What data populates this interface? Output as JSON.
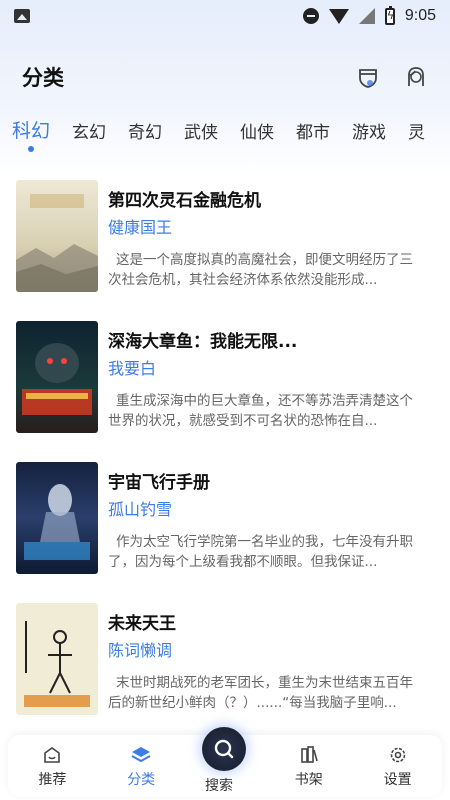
{
  "status": {
    "time": "9:05"
  },
  "header": {
    "title": "分类",
    "icons": [
      "shield-icon",
      "avatar-icon"
    ]
  },
  "tabs": [
    {
      "label": "科幻",
      "active": true
    },
    {
      "label": "玄幻",
      "active": false
    },
    {
      "label": "奇幻",
      "active": false
    },
    {
      "label": "武侠",
      "active": false
    },
    {
      "label": "仙侠",
      "active": false
    },
    {
      "label": "都市",
      "active": false
    },
    {
      "label": "游戏",
      "active": false
    },
    {
      "label": "灵",
      "active": false
    }
  ],
  "books": [
    {
      "title": "第四次灵石金融危机",
      "author": "健康国王",
      "description": "这是一个高度拟真的高魔社会，即便文明经历了三次社会危机，其社会经济体系依然没能形成..."
    },
    {
      "title": "深海大章鱼：我能无限...",
      "author": "我要白",
      "description": "重生成深海中的巨大章鱼，还不等苏浩弄清楚这个世界的状况，就感受到不可名状的恐怖在自..."
    },
    {
      "title": "宇宙飞行手册",
      "author": "孤山钓雪",
      "description": "作为太空飞行学院第一名毕业的我，七年没有升职了，因为每个上级看我都不顺眼。但我保证..."
    },
    {
      "title": "未来天王",
      "author": "陈词懒调",
      "description": "末世时期战死的老军团长，重生为末世结束五百年后的新世纪小鲜肉（？）......“每当我脑子里响..."
    }
  ],
  "nav": {
    "recommend": "推荐",
    "category": "分类",
    "search": "搜索",
    "bookshelf": "书架",
    "settings": "设置"
  },
  "colors": {
    "accent": "#3d7be6"
  }
}
